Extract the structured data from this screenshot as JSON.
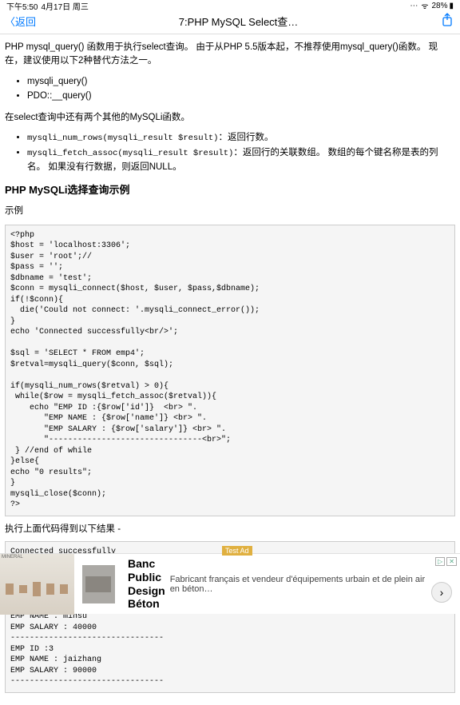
{
  "status": {
    "time": "下午5:50",
    "date": "4月17日 周三",
    "wifi": "⋯",
    "batt_pct": "28%",
    "batt_icon": "◧"
  },
  "nav": {
    "back": "返回",
    "title": "7:PHP MySQL Select查…"
  },
  "intro": "PHP mysql_query() 函数用于执行select查询。 由于从PHP 5.5版本起，不推荐使用mysql_query()函数。 现在，建议使用以下2种替代方法之一。",
  "alts": [
    "mysqli_query()",
    "PDO::__query()"
  ],
  "other_intro": "在select查询中还有两个其他的MySQLi函数。",
  "others": [
    {
      "fn": "mysqli_num_rows(mysqli_result $result)",
      "desc": "：返回行数。"
    },
    {
      "fn": "mysqli_fetch_assoc(mysqli_result $result)",
      "desc": "：返回行的关联数组。 数组的每个键名称是表的列名。 如果没有行数据，则返回NULL。"
    }
  ],
  "h3": "PHP MySQLi选择查询示例",
  "example_label": "示例",
  "code": "<?php\n$host = 'localhost:3306';\n$user = 'root';//\n$pass = '';\n$dbname = 'test';\n$conn = mysqli_connect($host, $user, $pass,$dbname);\nif(!$conn){\n  die('Could not connect: '.mysqli_connect_error());\n}\necho 'Connected successfully<br/>';\n\n$sql = 'SELECT * FROM emp4';\n$retval=mysqli_query($conn, $sql);\n\nif(mysqli_num_rows($retval) > 0){\n while($row = mysqli_fetch_assoc($retval)){\n    echo \"EMP ID :{$row['id']}  <br> \".\n       \"EMP NAME : {$row['name']} <br> \".\n       \"EMP SALARY : {$row['salary']} <br> \".\n       \"--------------------------------<br>\";\n } //end of while\n}else{\necho \"0 results\";\n}\nmysqli_close($conn);\n?>",
  "result_label": "执行上面代码得到以下结果 -",
  "result": "Connected successfully\nEMP ID :1\nEMP NAME : maxsu\nEMP SALARY : 9000\n--------------------------------\nEMP ID :2\nEMP NAME : minsu\nEMP SALARY : 40000\n--------------------------------\nEMP ID :3\nEMP NAME : jaizhang\nEMP SALARY : 90000\n--------------------------------",
  "ad": {
    "brand": "MINERAL",
    "title": "Banc Public Design Béton",
    "desc": "Fabricant français et vendeur d'équipements urbain et de plein air en béton…",
    "test": "Test Ad",
    "choices": "▷",
    "x": "✕"
  }
}
